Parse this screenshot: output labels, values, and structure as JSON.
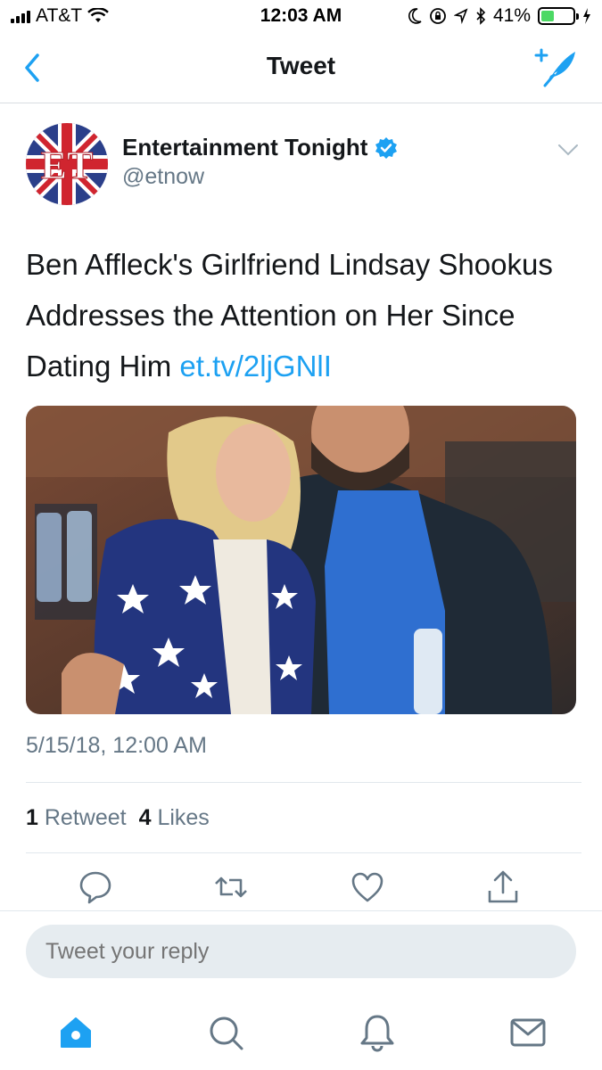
{
  "status_bar": {
    "carrier": "AT&T",
    "time": "12:03 AM",
    "battery": "41%",
    "battery_level": 0.41
  },
  "nav": {
    "title": "Tweet",
    "back_icon": "chevron-left-icon",
    "compose_icon": "compose-feather-icon"
  },
  "tweet": {
    "author_name": "Entertainment Tonight",
    "handle": "@etnow",
    "avatar_text": "ET",
    "text": "Ben Affleck's Girlfriend Lindsay Shookus Addresses the Attention on Her Since Dating Him ",
    "link": "et.tv/2ljGNlI",
    "timestamp": "5/15/18, 12:00 AM",
    "retweet_count": "1",
    "retweet_label": "Retweet",
    "like_count": "4",
    "like_label": "Likes"
  },
  "reply": {
    "placeholder": "Tweet your reply"
  },
  "colors": {
    "accent": "#1da1f2",
    "secondary_text": "#657786",
    "battery_green": "#4cd964"
  }
}
